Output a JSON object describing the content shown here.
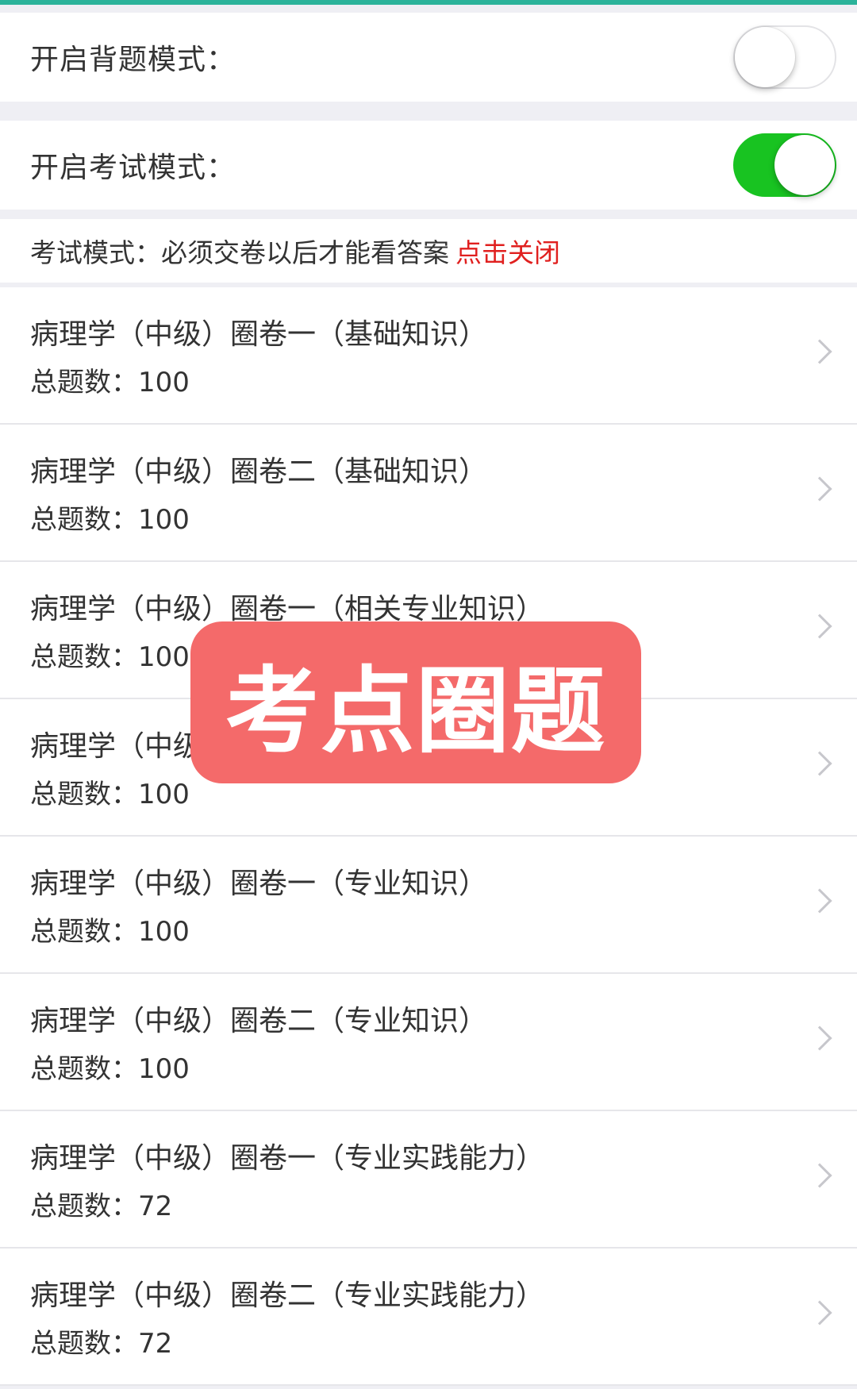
{
  "settings": {
    "recite_mode": {
      "label": "开启背题模式：",
      "enabled": false
    },
    "exam_mode": {
      "label": "开启考试模式：",
      "enabled": true
    },
    "hint": {
      "text": "考试模式：必须交卷以后才能看答案",
      "close_link": "点击关闭"
    }
  },
  "colors": {
    "accent_top": "#2bb39a",
    "switch_on": "#18c321",
    "link_red": "#e0201f",
    "stamp_bg": "#f46a6a"
  },
  "count_prefix": "总题数：",
  "papers": [
    {
      "title": "病理学（中级）圈卷一（基础知识）",
      "count": "100"
    },
    {
      "title": "病理学（中级）圈卷二（基础知识）",
      "count": "100"
    },
    {
      "title": "病理学（中级）圈卷一（相关专业知识）",
      "count": "100"
    },
    {
      "title": "病理学（中级）圈卷二（相关专业知识）",
      "count": "100"
    },
    {
      "title": "病理学（中级）圈卷一（专业知识）",
      "count": "100"
    },
    {
      "title": "病理学（中级）圈卷二（专业知识）",
      "count": "100"
    },
    {
      "title": "病理学（中级）圈卷一（专业实践能力）",
      "count": "72"
    },
    {
      "title": "病理学（中级）圈卷二（专业实践能力）",
      "count": "72"
    }
  ],
  "overlay_stamp": "考点圈题"
}
